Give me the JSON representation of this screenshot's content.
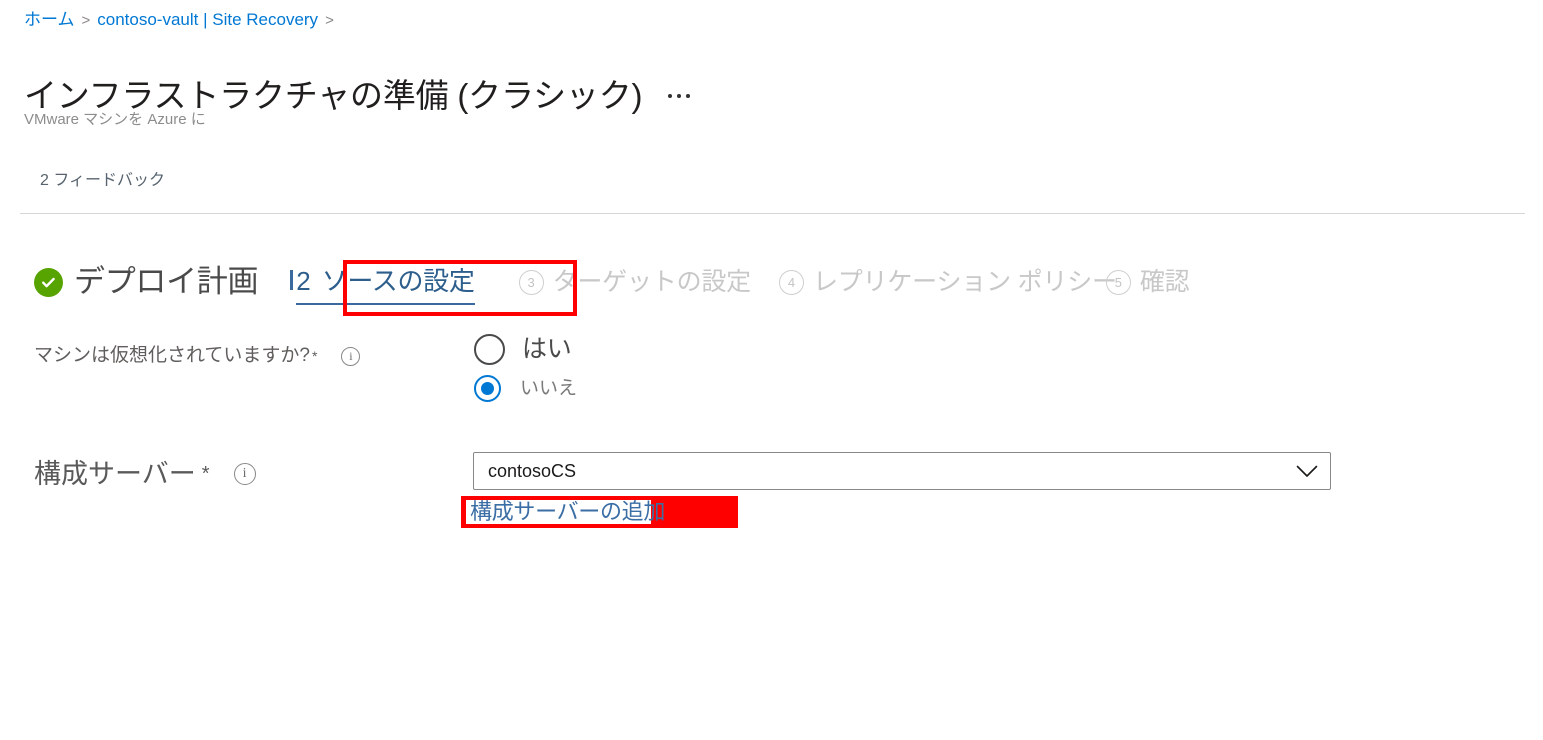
{
  "breadcrumb": {
    "items": [
      {
        "label": "ホーム",
        "type": "link"
      },
      {
        "label": ">",
        "type": "separator"
      },
      {
        "label": "contoso-vault | Site Recovery",
        "type": "link"
      },
      {
        "label": ">",
        "type": "separator"
      }
    ]
  },
  "header": {
    "title": "インフラストラクチャの準備 (クラシック)",
    "subtitle": "VMware マシンを Azure に",
    "more_menu_icon": "ellipsis-horizontal-icon",
    "feedback": "2 フィードバック"
  },
  "wizard": {
    "steps": [
      {
        "number": "1",
        "label": "デプロイ計画",
        "state": "completed",
        "icon": "check-circle-icon"
      },
      {
        "number": "2",
        "label": "ソースの設定",
        "state": "active"
      },
      {
        "number": "3",
        "label": "ターゲットの設定",
        "state": "disabled"
      },
      {
        "number": "4",
        "label": "レプリケーション ポリシー",
        "state": "disabled"
      },
      {
        "number": "5",
        "label": "確認",
        "state": "disabled"
      }
    ]
  },
  "form": {
    "virtualized": {
      "label": "マシンは仮想化されていますか?",
      "required_marker": "*",
      "info_icon": "info-icon",
      "info_glyph": "i",
      "options": [
        {
          "label": "はい",
          "selected": false
        },
        {
          "label": "いいえ",
          "selected": true
        }
      ]
    },
    "configuration_server": {
      "label": "構成サーバー",
      "required_marker": "*",
      "info_icon": "info-icon",
      "info_glyph": "i",
      "selected_value": "contosoCS",
      "dropdown_icon": "chevron-down-icon",
      "add_link": "構成サーバーの追加"
    }
  },
  "annotations": {
    "highlight_color": "#ff0000",
    "targets": [
      "step-source-settings",
      "add-configuration-server-link"
    ]
  },
  "colors": {
    "accent_blue": "#0078d4",
    "link_blue": "#3b6ea5",
    "completed_green": "#57a300",
    "annotation_red": "#ff0000",
    "muted_gray": "#c8c8c8"
  }
}
